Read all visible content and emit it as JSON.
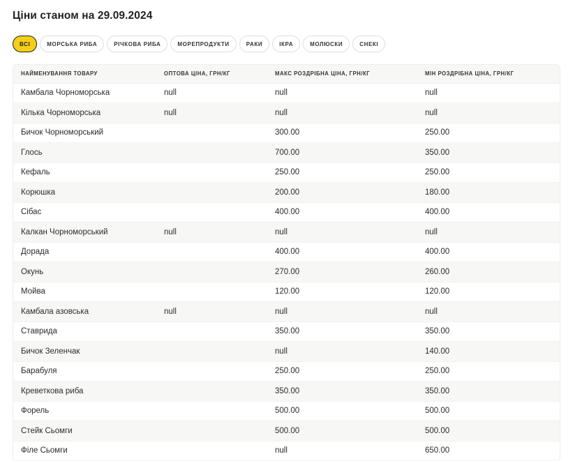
{
  "header": {
    "title": "Ціни станом на 29.09.2024"
  },
  "filters": [
    {
      "label": "Всі",
      "active": true
    },
    {
      "label": "Морська риба",
      "active": false
    },
    {
      "label": "Річкова риба",
      "active": false
    },
    {
      "label": "Морепродукти",
      "active": false
    },
    {
      "label": "Раки",
      "active": false
    },
    {
      "label": "Ікра",
      "active": false
    },
    {
      "label": "Молюски",
      "active": false
    },
    {
      "label": "Снекі",
      "active": false
    }
  ],
  "table": {
    "columns": [
      "Найменування товару",
      "Оптова ціна, грн/кг",
      "Макс роздрібна ціна, грн/кг",
      "Мін роздрібна ціна, грн/кг"
    ],
    "rows": [
      [
        "Камбала Чорноморська",
        "null",
        "null",
        "null"
      ],
      [
        "Кілька Чорноморська",
        "null",
        "null",
        "null"
      ],
      [
        "Бичок Чорноморський",
        "",
        "300.00",
        "250.00"
      ],
      [
        "Глось",
        "",
        "700.00",
        "350.00"
      ],
      [
        "Кефаль",
        "",
        "250.00",
        "250.00"
      ],
      [
        "Корюшка",
        "",
        "200.00",
        "180.00"
      ],
      [
        "Сібас",
        "",
        "400.00",
        "400.00"
      ],
      [
        "Калкан Чорноморський",
        "null",
        "null",
        "null"
      ],
      [
        "Дорада",
        "",
        "400.00",
        "400.00"
      ],
      [
        "Окунь",
        "",
        "270.00",
        "260.00"
      ],
      [
        "Мойва",
        "",
        "120.00",
        "120.00"
      ],
      [
        "Камбала азовська",
        "null",
        "null",
        "null"
      ],
      [
        "Ставрида",
        "",
        "350.00",
        "350.00"
      ],
      [
        "Бичок Зеленчак",
        "",
        "null",
        "140.00"
      ],
      [
        "Барабуля",
        "",
        "250.00",
        "250.00"
      ],
      [
        "Креветкова риба",
        "",
        "350.00",
        "350.00"
      ],
      [
        "Форель",
        "",
        "500.00",
        "500.00"
      ],
      [
        "Стейк Сьомги",
        "",
        "500.00",
        "500.00"
      ],
      [
        "Філе Сьомги",
        "",
        "null",
        "650.00"
      ]
    ]
  },
  "colors": {
    "active_chip": "#f5cf17",
    "row_alt": "#f7f8f6"
  }
}
